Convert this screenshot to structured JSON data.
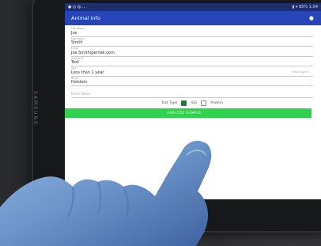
{
  "device": {
    "brand": "SAMSUNG"
  },
  "status_bar": {
    "left": "● ◎ ◍ ...",
    "right": "▮ ▾ 85% 1:04"
  },
  "app_bar": {
    "title": "Animal Info",
    "settings_icon": "gear-icon"
  },
  "fields": [
    {
      "label": "First Name",
      "value": "Joe"
    },
    {
      "label": "Last Name",
      "value": "Smith"
    },
    {
      "label": "Email",
      "value": "Joe.Smith@email.com"
    },
    {
      "label": "Animal ID",
      "value": "Test"
    },
    {
      "label": "Age",
      "value": "Less than 1 year",
      "extra": "Select Age ▾"
    },
    {
      "label": "Breed",
      "value": "Holstein"
    }
  ],
  "notes": {
    "placeholder": "Enter Notes"
  },
  "test_type": {
    "label": "Test Type",
    "options": [
      {
        "label": "IGG",
        "checked": true
      },
      {
        "label": "Protein",
        "checked": false
      }
    ]
  },
  "action": {
    "label": "ANALYZE SAMPLE"
  },
  "colors": {
    "appbar": "#2745b8",
    "statusbar": "#1f2f6e",
    "button": "#2fd14d",
    "glove": "#6f96c9"
  }
}
